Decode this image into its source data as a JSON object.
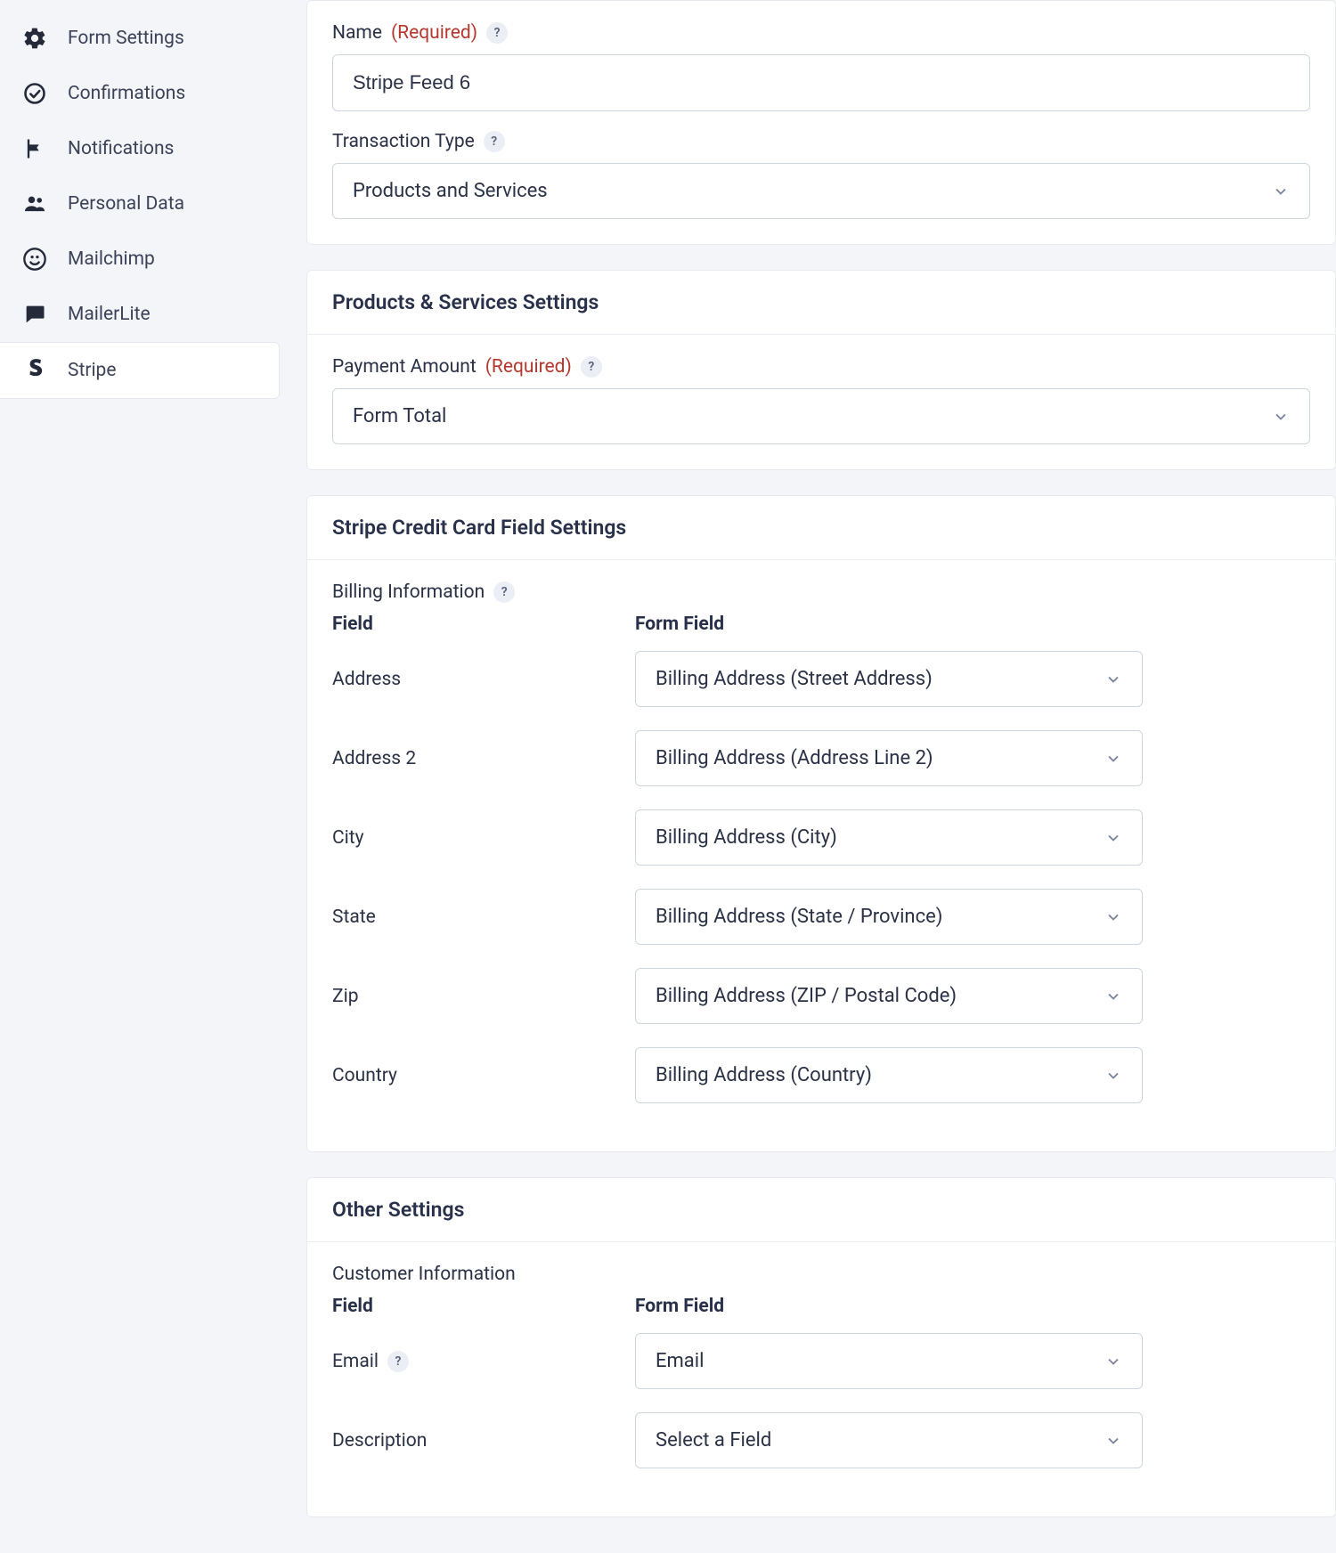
{
  "sidebar": {
    "items": [
      {
        "label": "Form Settings",
        "icon": "gear"
      },
      {
        "label": "Confirmations",
        "icon": "check-circle"
      },
      {
        "label": "Notifications",
        "icon": "flag"
      },
      {
        "label": "Personal Data",
        "icon": "people"
      },
      {
        "label": "Mailchimp",
        "icon": "mailchimp"
      },
      {
        "label": "MailerLite",
        "icon": "chat"
      },
      {
        "label": "Stripe",
        "icon": "stripe"
      }
    ],
    "active_index": 6
  },
  "sections": {
    "feed": {
      "name_label": "Name",
      "name_required": "(Required)",
      "name_value": "Stripe Feed 6",
      "txn_label": "Transaction Type",
      "txn_value": "Products and Services"
    },
    "products": {
      "title": "Products & Services Settings",
      "amount_label": "Payment Amount",
      "amount_required": "(Required)",
      "amount_value": "Form Total"
    },
    "card": {
      "title": "Stripe Credit Card Field Settings",
      "billing_label": "Billing Information",
      "col_field": "Field",
      "col_form_field": "Form Field",
      "rows": [
        {
          "label": "Address",
          "value": "Billing Address (Street Address)"
        },
        {
          "label": "Address 2",
          "value": "Billing Address (Address Line 2)"
        },
        {
          "label": "City",
          "value": "Billing Address (City)"
        },
        {
          "label": "State",
          "value": "Billing Address (State / Province)"
        },
        {
          "label": "Zip",
          "value": "Billing Address (ZIP / Postal Code)"
        },
        {
          "label": "Country",
          "value": "Billing Address (Country)"
        }
      ]
    },
    "other": {
      "title": "Other Settings",
      "cust_label": "Customer Information",
      "col_field": "Field",
      "col_form_field": "Form Field",
      "rows": [
        {
          "label": "Email",
          "value": "Email",
          "help": true
        },
        {
          "label": "Description",
          "value": "Select a Field",
          "help": false
        }
      ]
    }
  },
  "glyphs": {
    "help": "?"
  }
}
